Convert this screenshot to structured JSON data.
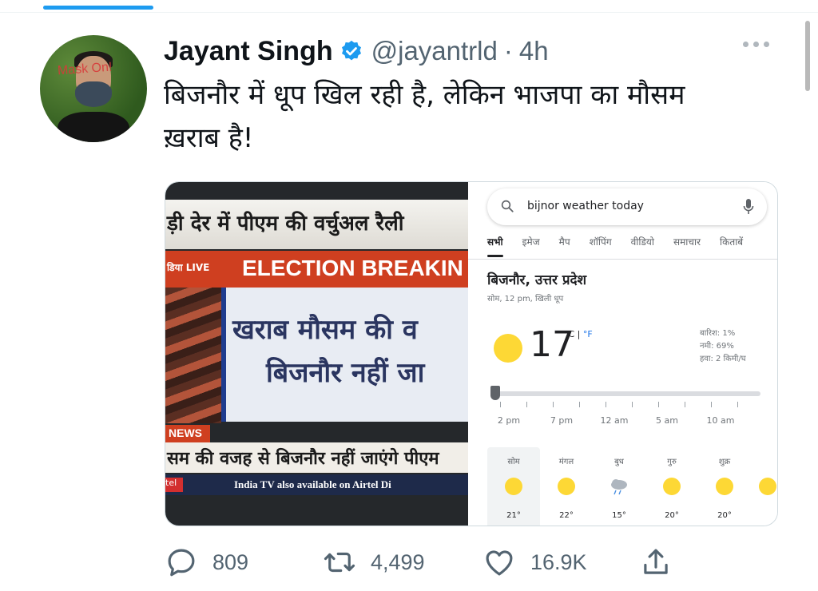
{
  "tweet": {
    "author_name": "Jayant Singh",
    "handle": "@jayantrld",
    "separator": "·",
    "time": "4h",
    "text_line1": "बिजनौर में धूप खिल रही है, लेकिन भाजपा का मौसम",
    "text_line2": "ख़राब है!",
    "avatar_text": "Mask On!"
  },
  "media": {
    "tv": {
      "top_text": "ड़ी देर में पीएम की वर्चुअल रैली",
      "live_label": "डिया LIVE",
      "breaking_text": "ELECTION BREAKIN",
      "board_line1": "खराब मौसम की व",
      "board_line2": "बिजनौर नहीं जा",
      "news_tag": "NEWS",
      "ticker_text": "सम की वजह से बिजनौर नहीं जाएंगे पीएम",
      "bottom_text": "India TV also available on Airtel Di",
      "tel_label": "tel"
    },
    "google": {
      "query": "bijnor weather today",
      "tabs": [
        "सभी",
        "इमेज",
        "मैप",
        "शॉपिंग",
        "वीडियो",
        "समाचार",
        "किताबें"
      ],
      "location": "बिजनौर, उत्तर प्रदेश",
      "subline": "सोम, 12 pm, खिली धूप",
      "temperature": "17",
      "unit_c": "°C",
      "unit_sep": " | ",
      "unit_f": "°F",
      "rain": "बारिश: 1%",
      "humidity": "नमी: 69%",
      "wind": "हवा: 2 किमी/घ",
      "hours": [
        "2 pm",
        "7 pm",
        "12 am",
        "5 am",
        "10 am"
      ],
      "days": [
        {
          "name": "सोम",
          "icon": "sun-icon",
          "temp": "21°"
        },
        {
          "name": "मंगल",
          "icon": "sun-icon",
          "temp": "22°"
        },
        {
          "name": "बुध",
          "icon": "rain-cloud-icon",
          "temp": "15°"
        },
        {
          "name": "गुरु",
          "icon": "sun-icon",
          "temp": "20°"
        },
        {
          "name": "शुक्र",
          "icon": "sun-icon",
          "temp": "20°"
        }
      ]
    }
  },
  "actions": {
    "replies": "809",
    "retweets": "4,499",
    "likes": "16.9K"
  },
  "colors": {
    "accent": "#1d9bf0",
    "text_secondary": "#536471",
    "sun": "#fdd835"
  }
}
